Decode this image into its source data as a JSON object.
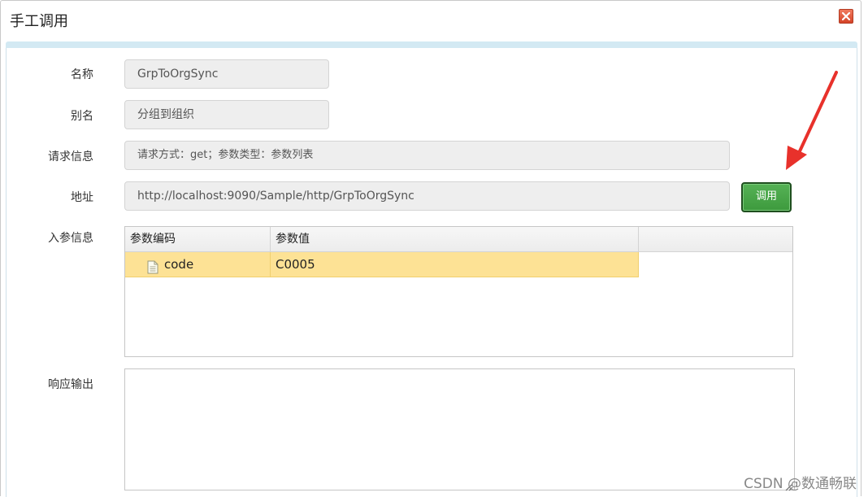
{
  "dialog": {
    "title": "手工调用",
    "close_icon": "close-icon"
  },
  "form": {
    "name_label": "名称",
    "name_value": "GrpToOrgSync",
    "alias_label": "别名",
    "alias_value": "分组到组织",
    "request_label": "请求信息",
    "request_value": "请求方式：get；参数类型：参数列表",
    "address_label": "地址",
    "address_value": "http://localhost:9090/Sample/http/GrpToOrgSync",
    "invoke_button": "调用",
    "params_label": "入参信息",
    "response_label": "响应输出"
  },
  "params_table": {
    "columns": [
      "参数编码",
      "参数值"
    ],
    "rows": [
      {
        "code": "code",
        "value": "C0005",
        "icon": "document-icon"
      }
    ],
    "selected_row_color": "#fde295"
  },
  "annotation": {
    "arrow_color": "#e8312b"
  },
  "watermark": "CSDN @数通畅联"
}
